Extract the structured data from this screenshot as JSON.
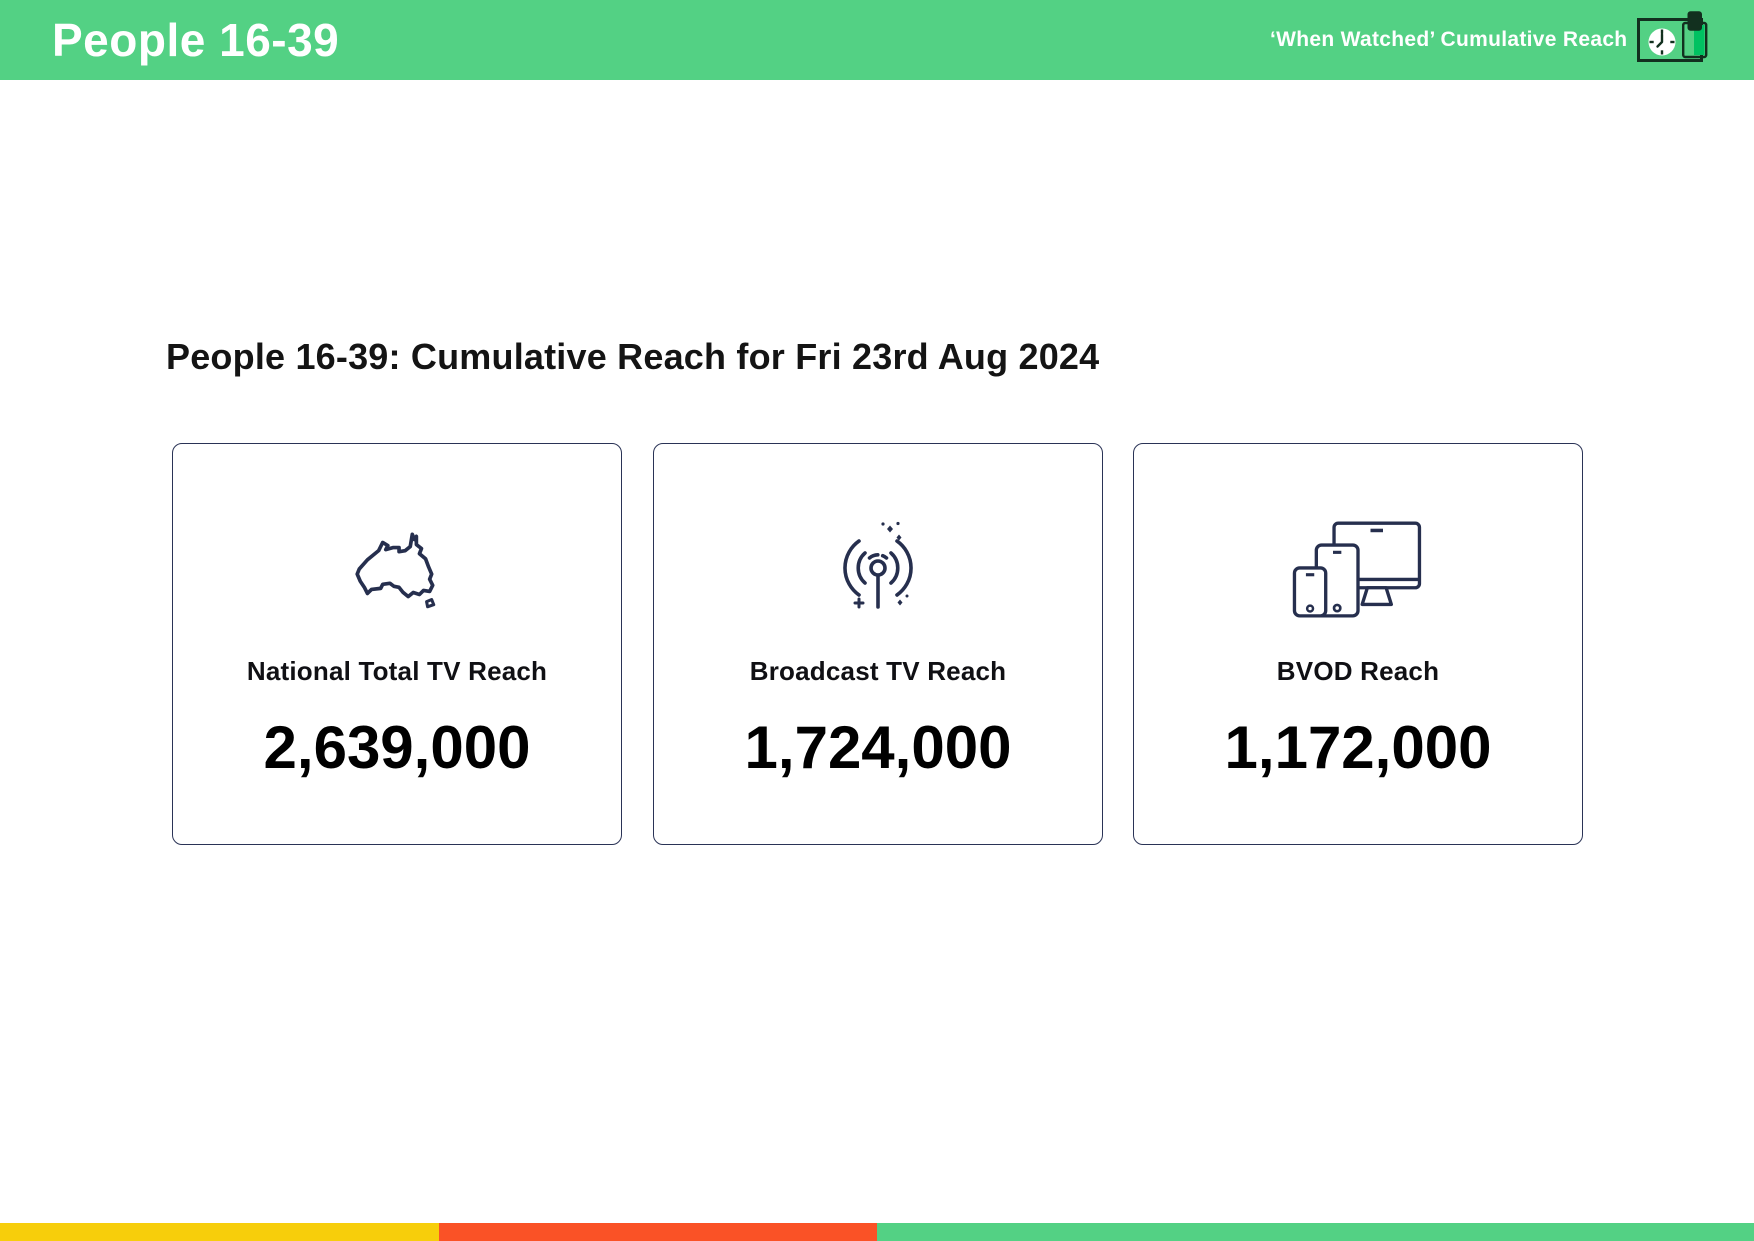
{
  "header": {
    "title": "People 16-39",
    "tagline": "‘When Watched’ Cumulative Reach",
    "icons": [
      "clock-icon",
      "device-icon"
    ],
    "bg_color": "#53D184"
  },
  "main": {
    "heading": "People 16-39: Cumulative Reach for Fri 23rd Aug 2024",
    "cards": [
      {
        "icon": "australia-map-icon",
        "label": "National Total TV Reach",
        "value": "2,639,000"
      },
      {
        "icon": "broadcast-antenna-icon",
        "label": "Broadcast TV Reach",
        "value": "1,724,000"
      },
      {
        "icon": "connected-devices-icon",
        "label": "BVOD Reach",
        "value": "1,172,000"
      }
    ]
  },
  "footer": {
    "segments": [
      {
        "name": "yellow-segment",
        "color": "#F7CE0B",
        "width_pct": "25%"
      },
      {
        "name": "red-segment",
        "color": "#FA5226",
        "width_pct": "25%"
      },
      {
        "name": "green-segment",
        "color": "#53D184",
        "width_pct": "50%"
      }
    ]
  },
  "colors": {
    "header_bg": "#53D184",
    "icon_stroke": "#262F4E",
    "card_border": "#2A3356",
    "header_icon_stroke": "#12301F",
    "battery_fill": "#00C161",
    "heading_text": "#141414",
    "value_text": "#000000"
  }
}
